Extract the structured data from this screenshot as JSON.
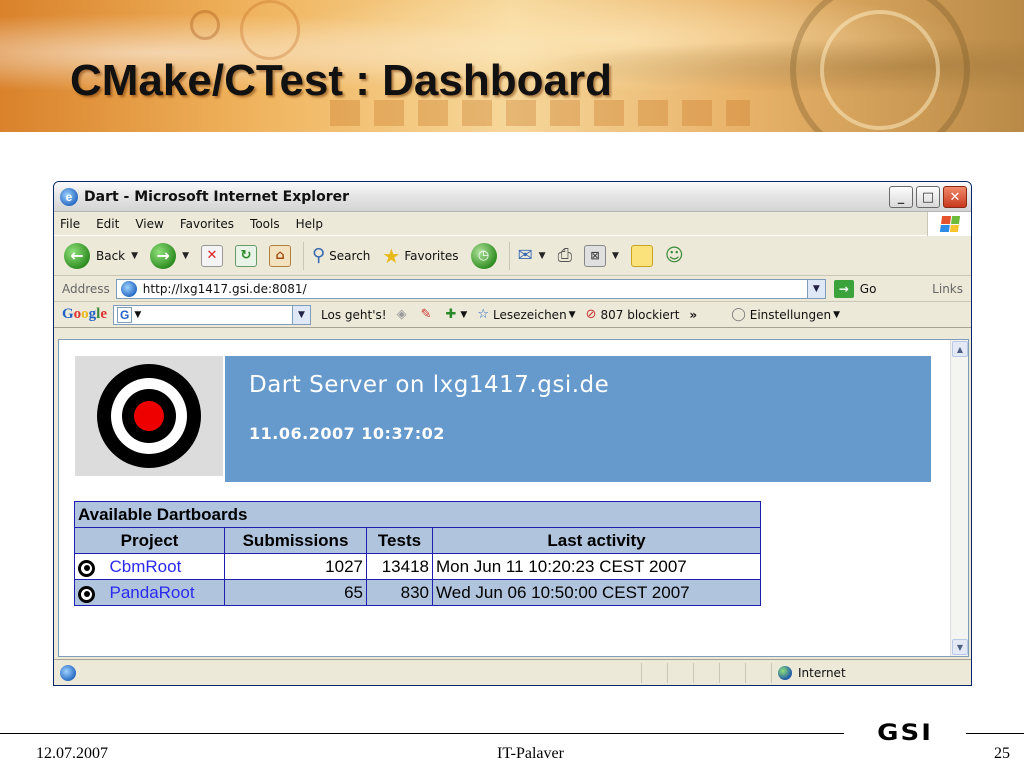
{
  "slide": {
    "title": "CMake/CTest : Dashboard",
    "footer": {
      "date": "12.07.2007",
      "center": "IT-Palaver",
      "page": "25",
      "logo_text": "GSI"
    }
  },
  "browser": {
    "window_title": "Dart - Microsoft Internet Explorer",
    "menu": [
      "File",
      "Edit",
      "View",
      "Favorites",
      "Tools",
      "Help"
    ],
    "toolbar": {
      "back": "Back",
      "search": "Search",
      "favorites": "Favorites"
    },
    "address": {
      "label": "Address",
      "url": "http://lxg1417.gsi.de:8081/",
      "go": "Go",
      "links": "Links"
    },
    "googlebar": {
      "logo": "Google",
      "g_button": "G",
      "los": "Los geht's!",
      "bookmarks": "Lesezeichen",
      "blocked": "807 blockiert",
      "more": "»",
      "settings": "Einstellungen"
    },
    "status": {
      "zone": "Internet"
    }
  },
  "dart": {
    "server_title": "Dart Server on lxg1417.gsi.de",
    "timestamp": "11.06.2007 10:37:02",
    "table": {
      "caption": "Available Dartboards",
      "headers": [
        "Project",
        "Submissions",
        "Tests",
        "Last activity"
      ],
      "rows": [
        {
          "project": "CbmRoot",
          "submissions": "1027",
          "tests": "13418",
          "last_activity": "Mon Jun 11 10:20:23 CEST 2007"
        },
        {
          "project": "PandaRoot",
          "submissions": "65",
          "tests": "830",
          "last_activity": "Wed Jun 06 10:50:00 CEST 2007"
        }
      ]
    }
  },
  "colors": {
    "dart_header_blue": "#6699cc",
    "table_blue": "#b0c4de",
    "link": "#2a2aee"
  },
  "icons": [
    "ie-icon",
    "back-arrow-icon",
    "forward-arrow-icon",
    "stop-icon",
    "refresh-icon",
    "home-icon",
    "search-icon",
    "favorites-star-icon",
    "history-icon",
    "mail-icon",
    "print-icon",
    "edit-icon",
    "notes-icon",
    "messenger-icon",
    "go-arrow-icon",
    "bullseye-icon",
    "globe-icon",
    "windows-logo-icon"
  ]
}
